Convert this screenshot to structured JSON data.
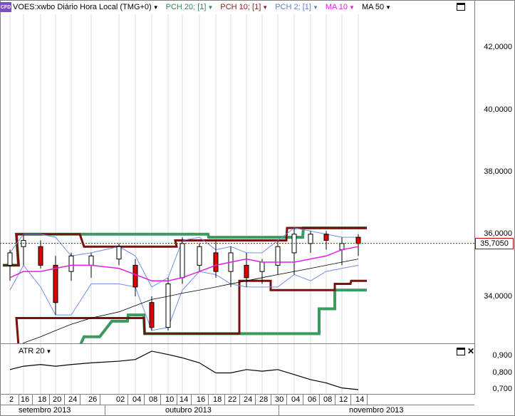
{
  "legend": {
    "badge": "CFD",
    "instrument": "VOES:xwbo Diário Hora Local (TMG+0)",
    "indicators": [
      {
        "label": "PCH 20; [1]",
        "color": "#2e8b57"
      },
      {
        "label": "PCH 10; [1]",
        "color": "#8b1a1a"
      },
      {
        "label": "PCH 2; [1]",
        "color": "#5b7fd6"
      },
      {
        "label": "MA 10",
        "color": "#e020e0"
      },
      {
        "label": "MA 50",
        "color": "#000000"
      }
    ]
  },
  "colors": {
    "pch20": "#3a9a60",
    "pch10": "#7a1010",
    "pch2": "#7090e8",
    "ma10": "#e020e0",
    "ma50": "#000000",
    "up_candle": "#ffffff",
    "down_candle": "#e00000",
    "price_line": "#c00000"
  },
  "price_axis": {
    "ticks": [
      "42,0000",
      "40,0000",
      "38,0000",
      "36,0000",
      "34,0000"
    ],
    "current_price": "35,7050"
  },
  "atr_panel": {
    "label": "ATR 20",
    "ticks": [
      "0,900",
      "0,800",
      "0,700"
    ]
  },
  "time_axis": {
    "days": [
      "2",
      "16",
      "18",
      "20",
      "24",
      "26",
      "02",
      "04",
      "08",
      "10",
      "14",
      "16",
      "18",
      "22",
      "24",
      "28",
      "30",
      "04",
      "06",
      "08",
      "12",
      "14"
    ],
    "months": [
      "setembro 2013",
      "outubro 2013",
      "novembro 2013"
    ]
  },
  "chart_data": [
    {
      "type": "candlestick",
      "title": "VOES:xwbo Diário Hora Local (TMG+0)",
      "ylim": [
        32.5,
        43.0
      ],
      "current_price": 35.705,
      "x": [
        "2",
        "16",
        "18",
        "20",
        "24",
        "26",
        "02",
        "04",
        "08",
        "10",
        "14",
        "16",
        "18",
        "22",
        "24",
        "28",
        "30",
        "04",
        "06",
        "08",
        "12",
        "14"
      ],
      "series": [
        {
          "name": "PCH 20; [1]",
          "values": [
            35.0,
            36.0,
            36.0,
            36.0,
            36.0,
            36.0,
            36.0,
            36.0,
            36.0,
            36.0,
            36.0,
            36.0,
            35.9,
            35.9,
            35.9,
            35.9,
            35.9,
            35.9,
            36.2,
            36.2,
            36.2,
            36.2
          ]
        },
        {
          "name": "PCH 10; [1]",
          "values": [
            35.0,
            36.0,
            36.0,
            36.0,
            36.0,
            35.6,
            35.6,
            35.6,
            35.6,
            35.6,
            35.8,
            35.8,
            35.8,
            35.8,
            35.8,
            35.8,
            35.8,
            36.2,
            36.2,
            36.2,
            36.2,
            36.2
          ]
        },
        {
          "name": "MA 10",
          "values": [
            34.6,
            34.8,
            34.8,
            34.9,
            35.0,
            35.0,
            34.9,
            34.7,
            34.5,
            34.5,
            34.6,
            34.8,
            35.0,
            35.1,
            35.2,
            35.1,
            35.1,
            35.1,
            35.2,
            35.3,
            35.5,
            35.6
          ]
        },
        {
          "name": "MA 50",
          "values": [
            32.2,
            32.5,
            32.7,
            32.9,
            33.1,
            33.3,
            33.5,
            33.7,
            33.9,
            34.0,
            34.1,
            34.2,
            34.3,
            34.4,
            34.5,
            34.6,
            34.7,
            34.8,
            34.9,
            35.0,
            35.1,
            35.2
          ]
        }
      ]
    },
    {
      "type": "line",
      "title": "ATR 20",
      "ylim": [
        0.68,
        0.95
      ],
      "x": [
        "2",
        "16",
        "18",
        "20",
        "24",
        "26",
        "02",
        "04",
        "08",
        "10",
        "14",
        "16",
        "18",
        "22",
        "24",
        "28",
        "30",
        "04",
        "06",
        "08",
        "12",
        "14"
      ],
      "series": [
        {
          "name": "ATR 20",
          "values": [
            0.82,
            0.84,
            0.85,
            0.84,
            0.85,
            0.86,
            0.87,
            0.88,
            0.93,
            0.91,
            0.89,
            0.86,
            0.8,
            0.8,
            0.82,
            0.81,
            0.82,
            0.79,
            0.76,
            0.74,
            0.71,
            0.7
          ]
        }
      ]
    }
  ]
}
